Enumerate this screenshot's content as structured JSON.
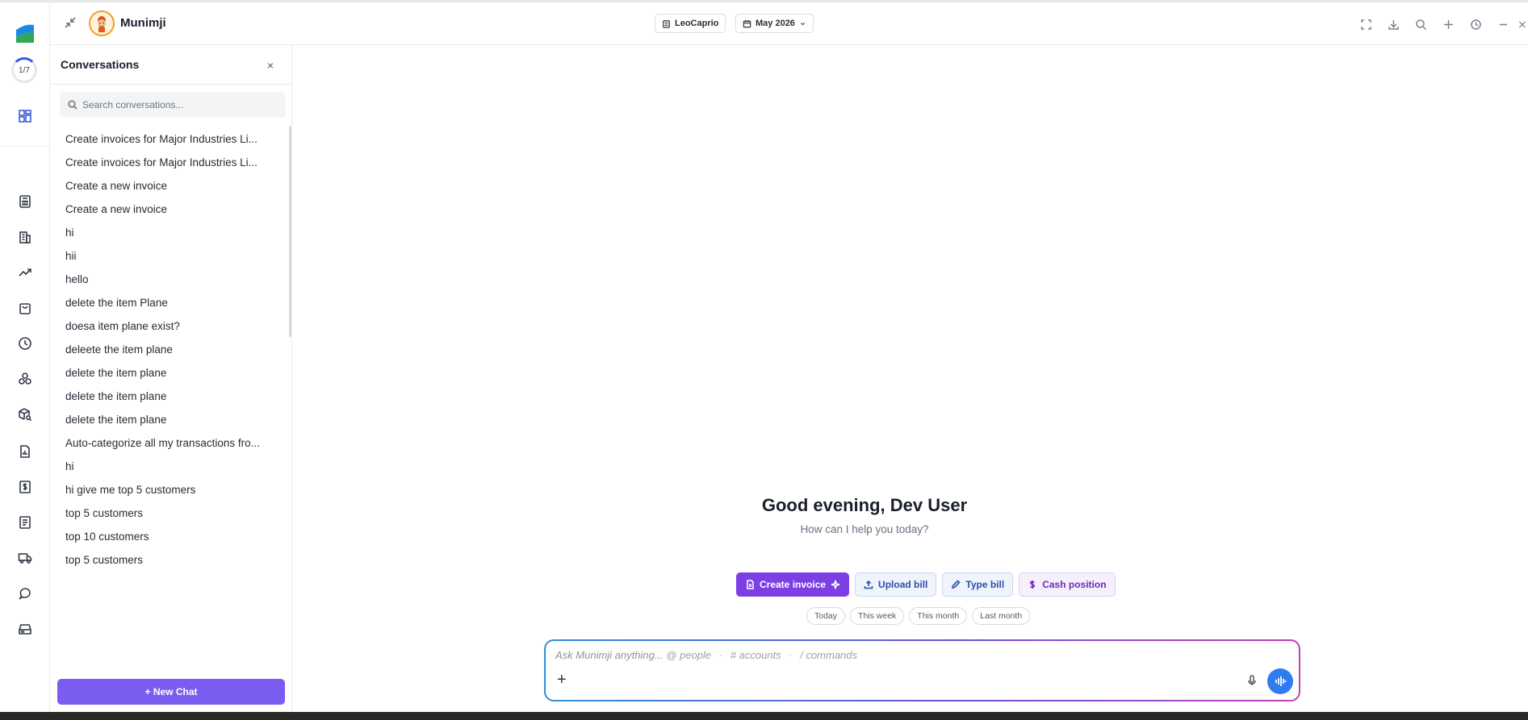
{
  "header": {
    "app_title": "Munimji",
    "company": "LeoCaprio",
    "period": "May 2026"
  },
  "rail": {
    "progress": "1/7",
    "icons": [
      "dashboard-icon",
      "calculator-icon",
      "building-icon",
      "trending-up-icon",
      "shopping-bag-icon",
      "clock-icon",
      "boxes-icon",
      "package-search-icon",
      "report-icon",
      "dollar-receipt-icon",
      "document-icon",
      "truck-icon",
      "chat-icon",
      "inbox-icon"
    ]
  },
  "conversations": {
    "title": "Conversations",
    "close": "×",
    "search_placeholder": "Search conversations...",
    "items": [
      "Create invoices for Major Industries Li...",
      "Create invoices for Major Industries Li...",
      "Create a new invoice",
      "Create a new invoice",
      "hi",
      "hii",
      "hello",
      "delete the item Plane",
      "doesa item plane exist?",
      "deleete the item plane",
      "delete the item plane",
      "delete the item plane",
      "delete the item plane",
      "Auto-categorize all my transactions fro...",
      "hi",
      "hi give me top 5 customers",
      "top 5 customers",
      "top 10 customers",
      "top 5 customers"
    ],
    "new_chat": "+ New Chat"
  },
  "main": {
    "greeting": "Good evening, Dev User",
    "subtitle": "How can I help you today?",
    "actions": {
      "create_invoice": "Create invoice",
      "upload_bill": "Upload bill",
      "type_bill": "Type bill",
      "cash_position": "Cash position"
    },
    "chips": [
      "Today",
      "This week",
      "This month",
      "Last month"
    ],
    "composer": {
      "placeholder": "Ask Munimji anything...",
      "hint_people": "@ people",
      "hint_accounts": "# accounts",
      "hint_commands": "/ commands"
    }
  },
  "colors": {
    "accent": "#7b5cf0",
    "primary_action": "#7b3fe4",
    "send": "#2f7cf0"
  }
}
